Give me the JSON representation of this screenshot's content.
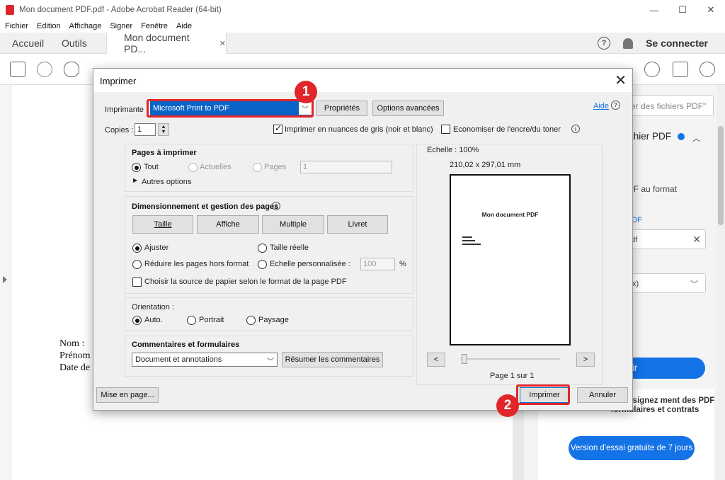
{
  "window": {
    "title": "Mon document PDF.pdf - Adobe Acrobat Reader (64-bit)",
    "minimize": "—",
    "maximize": "☐",
    "close": "✕"
  },
  "menu": [
    "Fichier",
    "Edition",
    "Affichage",
    "Signer",
    "Fenêtre",
    "Aide"
  ],
  "tabs": {
    "home": "Accueil",
    "tools": "Outils",
    "doc": "Mon document PD...",
    "doc_close": "✕"
  },
  "header": {
    "help_icon": "?",
    "signin": "Se connecter"
  },
  "doc": {
    "nom": "Nom :",
    "prenom": "Prénom",
    "date": "Date de"
  },
  "rpanel": {
    "search_placeholder": "er des fichiers PDF\"",
    "heading": "chier PDF",
    "text1": "PDF au format",
    "text2": "DF",
    "box1_value": "df",
    "box2_value": "x)",
    "blue_btn": "rtir",
    "promo": "odifiez et signez ment des PDF formulaires et contrats",
    "trial": "Version d'essai gratuite de 7 jours"
  },
  "dialog": {
    "title": "Imprimer",
    "printer_label": "Imprimante :",
    "printer_value": "Microsoft Print to PDF",
    "properties": "Propriétés",
    "advanced": "Options avancées",
    "help": "Aide",
    "copies_label": "Copies :",
    "copies_value": "1",
    "grayscale": "Imprimer en nuances de gris (noir et blanc)",
    "save_ink": "Economiser de l'encre/du toner",
    "pages_title": "Pages à imprimer",
    "pages_all": "Tout",
    "pages_current": "Actuelles",
    "pages_pages": "Pages",
    "pages_input": "1",
    "more_options": "Autres options",
    "size_title": "Dimensionnement et gestion des pages",
    "size_btn": "Taille",
    "poster_btn": "Affiche",
    "multiple_btn": "Multiple",
    "booklet_btn": "Livret",
    "fit": "Ajuster",
    "actual_size": "Taille réelle",
    "shrink": "Réduire les pages hors format",
    "custom_scale": "Echelle personnalisée :",
    "scale_value": "100",
    "percent": "%",
    "paper_source": "Choisir la source de papier selon le format de la page PDF",
    "orientation_title": "Orientation :",
    "orient_auto": "Auto.",
    "orient_portrait": "Portrait",
    "orient_landscape": "Paysage",
    "comments_title": "Commentaires et formulaires",
    "comments_value": "Document et annotations",
    "summarize": "Résumer les commentaires",
    "scale_label": "Echelle : 100%",
    "dimensions": "210,02 x 297,01 mm",
    "preview_title": "Mon document PDF",
    "page_counter": "Page 1 sur 1",
    "prev": "<",
    "next": ">",
    "page_setup": "Mise en page...",
    "print": "Imprimer",
    "cancel": "Annuler"
  },
  "annotations": {
    "badge1": "1",
    "badge2": "2"
  },
  "colors": {
    "accent_red": "#e0262a",
    "acrobat_blue": "#1473e6",
    "printer_highlight": "#0a64c8"
  }
}
